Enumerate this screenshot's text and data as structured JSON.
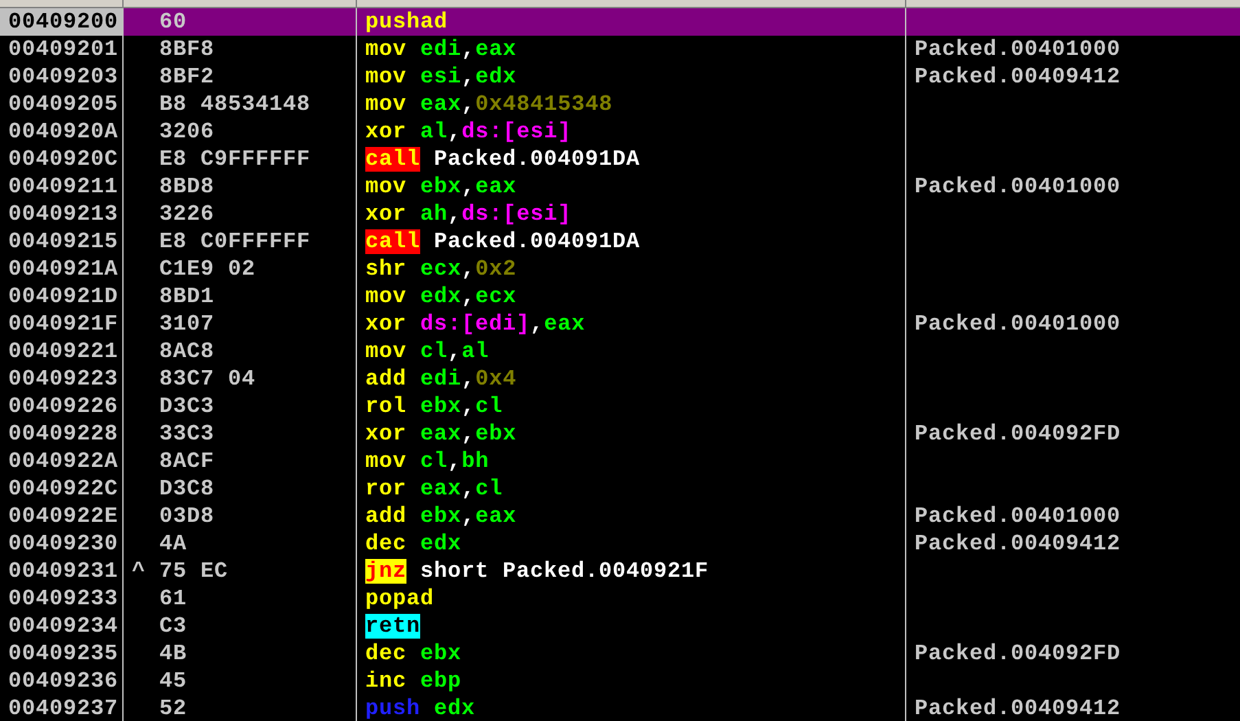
{
  "rows": [
    {
      "address": "00409200",
      "hex": "60",
      "mnemonic": {
        "text": "pushad",
        "kind": "plain"
      },
      "operands": [],
      "selected": true
    },
    {
      "address": "00409201",
      "hex": "8BF8",
      "mnemonic": {
        "text": "mov",
        "kind": "plain"
      },
      "operands": [
        {
          "text": "edi",
          "kind": "reg"
        },
        {
          "text": ",",
          "kind": "text"
        },
        {
          "text": "eax",
          "kind": "reg"
        }
      ],
      "comment": "Packed.00401000",
      "selected": false
    },
    {
      "address": "00409203",
      "hex": "8BF2",
      "mnemonic": {
        "text": "mov",
        "kind": "plain"
      },
      "operands": [
        {
          "text": "esi",
          "kind": "reg"
        },
        {
          "text": ",",
          "kind": "text"
        },
        {
          "text": "edx",
          "kind": "reg"
        }
      ],
      "comment": "Packed.00409412",
      "selected": false
    },
    {
      "address": "00409205",
      "hex": "B8 48534148",
      "mnemonic": {
        "text": "mov",
        "kind": "plain"
      },
      "operands": [
        {
          "text": "eax",
          "kind": "reg"
        },
        {
          "text": ",",
          "kind": "text"
        },
        {
          "text": "0x48415348",
          "kind": "imm"
        }
      ],
      "selected": false
    },
    {
      "address": "0040920A",
      "hex": "3206",
      "mnemonic": {
        "text": "xor",
        "kind": "plain"
      },
      "operands": [
        {
          "text": "al",
          "kind": "reg"
        },
        {
          "text": ",",
          "kind": "text"
        },
        {
          "text": "ds:[esi]",
          "kind": "mem"
        }
      ],
      "selected": false
    },
    {
      "address": "0040920C",
      "hex": "E8 C9FFFFFF",
      "mnemonic": {
        "text": "call",
        "kind": "call"
      },
      "operands": [
        {
          "text": "Packed.004091DA",
          "kind": "text"
        }
      ],
      "selected": false
    },
    {
      "address": "00409211",
      "hex": "8BD8",
      "mnemonic": {
        "text": "mov",
        "kind": "plain"
      },
      "operands": [
        {
          "text": "ebx",
          "kind": "reg"
        },
        {
          "text": ",",
          "kind": "text"
        },
        {
          "text": "eax",
          "kind": "reg"
        }
      ],
      "comment": "Packed.00401000",
      "selected": false
    },
    {
      "address": "00409213",
      "hex": "3226",
      "mnemonic": {
        "text": "xor",
        "kind": "plain"
      },
      "operands": [
        {
          "text": "ah",
          "kind": "reg"
        },
        {
          "text": ",",
          "kind": "text"
        },
        {
          "text": "ds:[esi]",
          "kind": "mem"
        }
      ],
      "selected": false
    },
    {
      "address": "00409215",
      "hex": "E8 C0FFFFFF",
      "mnemonic": {
        "text": "call",
        "kind": "call"
      },
      "operands": [
        {
          "text": "Packed.004091DA",
          "kind": "text"
        }
      ],
      "selected": false
    },
    {
      "address": "0040921A",
      "hex": "C1E9 02",
      "mnemonic": {
        "text": "shr",
        "kind": "plain"
      },
      "operands": [
        {
          "text": "ecx",
          "kind": "reg"
        },
        {
          "text": ",",
          "kind": "text"
        },
        {
          "text": "0x2",
          "kind": "imm"
        }
      ],
      "selected": false
    },
    {
      "address": "0040921D",
      "hex": "8BD1",
      "mnemonic": {
        "text": "mov",
        "kind": "plain"
      },
      "operands": [
        {
          "text": "edx",
          "kind": "reg"
        },
        {
          "text": ",",
          "kind": "text"
        },
        {
          "text": "ecx",
          "kind": "reg"
        }
      ],
      "selected": false
    },
    {
      "address": "0040921F",
      "hex": "3107",
      "mnemonic": {
        "text": "xor",
        "kind": "plain"
      },
      "operands": [
        {
          "text": "ds:[edi]",
          "kind": "mem"
        },
        {
          "text": ",",
          "kind": "text"
        },
        {
          "text": "eax",
          "kind": "reg"
        }
      ],
      "comment": "Packed.00401000",
      "selected": false
    },
    {
      "address": "00409221",
      "hex": "8AC8",
      "mnemonic": {
        "text": "mov",
        "kind": "plain"
      },
      "operands": [
        {
          "text": "cl",
          "kind": "reg"
        },
        {
          "text": ",",
          "kind": "text"
        },
        {
          "text": "al",
          "kind": "reg"
        }
      ],
      "selected": false
    },
    {
      "address": "00409223",
      "hex": "83C7 04",
      "mnemonic": {
        "text": "add",
        "kind": "plain"
      },
      "operands": [
        {
          "text": "edi",
          "kind": "reg"
        },
        {
          "text": ",",
          "kind": "text"
        },
        {
          "text": "0x4",
          "kind": "imm"
        }
      ],
      "selected": false
    },
    {
      "address": "00409226",
      "hex": "D3C3",
      "mnemonic": {
        "text": "rol",
        "kind": "plain"
      },
      "operands": [
        {
          "text": "ebx",
          "kind": "reg"
        },
        {
          "text": ",",
          "kind": "text"
        },
        {
          "text": "cl",
          "kind": "reg"
        }
      ],
      "selected": false
    },
    {
      "address": "00409228",
      "hex": "33C3",
      "mnemonic": {
        "text": "xor",
        "kind": "plain"
      },
      "operands": [
        {
          "text": "eax",
          "kind": "reg"
        },
        {
          "text": ",",
          "kind": "text"
        },
        {
          "text": "ebx",
          "kind": "reg"
        }
      ],
      "comment": "Packed.004092FD",
      "selected": false
    },
    {
      "address": "0040922A",
      "hex": "8ACF",
      "mnemonic": {
        "text": "mov",
        "kind": "plain"
      },
      "operands": [
        {
          "text": "cl",
          "kind": "reg"
        },
        {
          "text": ",",
          "kind": "text"
        },
        {
          "text": "bh",
          "kind": "reg"
        }
      ],
      "selected": false
    },
    {
      "address": "0040922C",
      "hex": "D3C8",
      "mnemonic": {
        "text": "ror",
        "kind": "plain"
      },
      "operands": [
        {
          "text": "eax",
          "kind": "reg"
        },
        {
          "text": ",",
          "kind": "text"
        },
        {
          "text": "cl",
          "kind": "reg"
        }
      ],
      "selected": false
    },
    {
      "address": "0040922E",
      "hex": "03D8",
      "mnemonic": {
        "text": "add",
        "kind": "plain"
      },
      "operands": [
        {
          "text": "ebx",
          "kind": "reg"
        },
        {
          "text": ",",
          "kind": "text"
        },
        {
          "text": "eax",
          "kind": "reg"
        }
      ],
      "comment": "Packed.00401000",
      "selected": false
    },
    {
      "address": "00409230",
      "hex": "4A",
      "mnemonic": {
        "text": "dec",
        "kind": "plain"
      },
      "operands": [
        {
          "text": "edx",
          "kind": "reg"
        }
      ],
      "comment": "Packed.00409412",
      "selected": false
    },
    {
      "address": "00409231",
      "jump_mark": "^",
      "hex": "75 EC",
      "mnemonic": {
        "text": "jnz",
        "kind": "jump"
      },
      "operands": [
        {
          "text": "short Packed.0040921F",
          "kind": "text"
        }
      ],
      "selected": false
    },
    {
      "address": "00409233",
      "hex": "61",
      "mnemonic": {
        "text": "popad",
        "kind": "plain"
      },
      "operands": [],
      "selected": false
    },
    {
      "address": "00409234",
      "hex": "C3",
      "mnemonic": {
        "text": "retn",
        "kind": "return"
      },
      "operands": [],
      "selected": false
    },
    {
      "address": "00409235",
      "hex": "4B",
      "mnemonic": {
        "text": "dec",
        "kind": "plain"
      },
      "operands": [
        {
          "text": "ebx",
          "kind": "reg"
        }
      ],
      "comment": "Packed.004092FD",
      "selected": false
    },
    {
      "address": "00409236",
      "hex": "45",
      "mnemonic": {
        "text": "inc",
        "kind": "plain"
      },
      "operands": [
        {
          "text": "ebp",
          "kind": "reg"
        }
      ],
      "selected": false
    },
    {
      "address": "00409237",
      "hex": "52",
      "mnemonic": {
        "text": "push",
        "kind": "stack"
      },
      "operands": [
        {
          "text": "edx",
          "kind": "reg"
        }
      ],
      "comment": "Packed.00409412",
      "selected": false
    }
  ]
}
